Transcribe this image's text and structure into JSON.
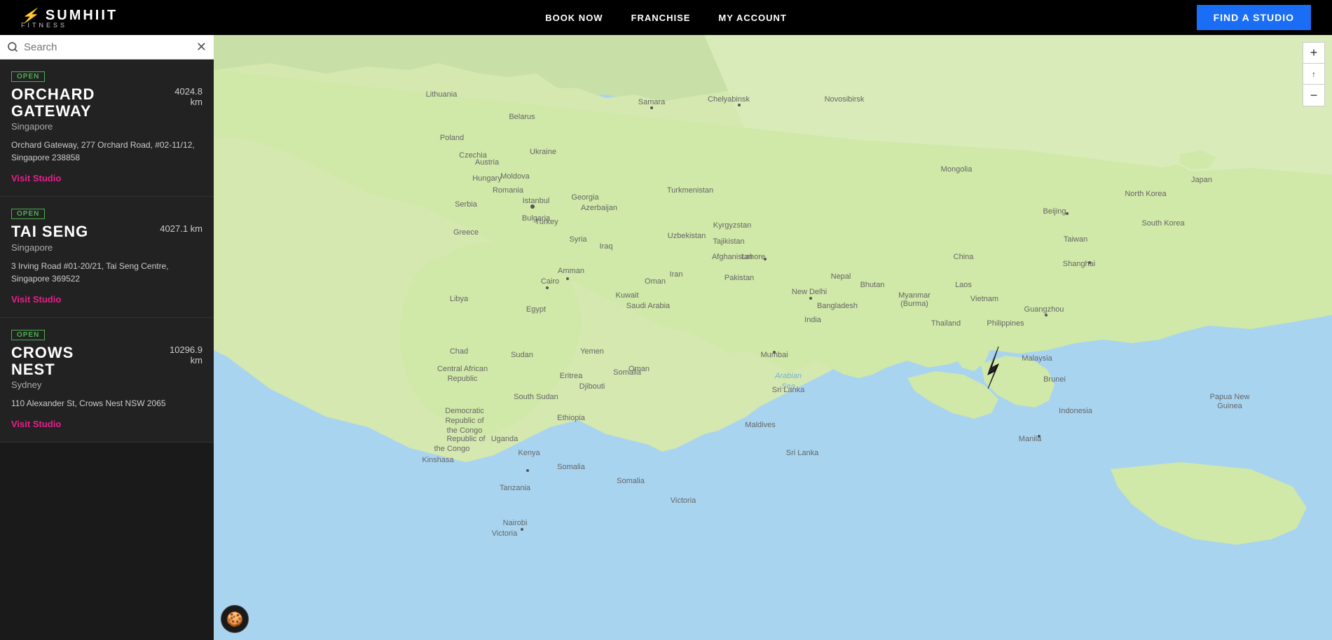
{
  "header": {
    "logo_main": "SUMHIIT",
    "logo_sub": "FITNESS",
    "nav": [
      {
        "label": "BOOK NOW",
        "id": "book-now"
      },
      {
        "label": "FRANCHISE",
        "id": "franchise"
      },
      {
        "label": "MY ACCOUNT",
        "id": "my-account"
      }
    ],
    "find_studio_label": "FIND A STUDIO"
  },
  "search": {
    "placeholder": "Search",
    "value": ""
  },
  "studios": [
    {
      "status": "OPEN",
      "name": "ORCHARD\nGATEWAY",
      "city": "Singapore",
      "distance": "4024.8\nkm",
      "address": "Orchard Gateway, 277 Orchard Road, #02-11/12, Singapore 238858",
      "visit_label": "Visit Studio"
    },
    {
      "status": "OPEN",
      "name": "TAI SENG",
      "city": "Singapore",
      "distance": "4027.1 km",
      "address": "3 Irving Road #01-20/21, Tai Seng Centre, Singapore 369522",
      "visit_label": "Visit Studio"
    },
    {
      "status": "OPEN",
      "name": "CROWS\nNEST",
      "city": "Sydney",
      "distance": "10296.9\nkm",
      "address": "110 Alexander St, Crows Nest NSW 2065",
      "visit_label": "Visit Studio"
    }
  ],
  "map": {
    "zoom_in": "+",
    "zoom_reset": "⊙",
    "zoom_out": "−",
    "south_korea_label": "South Korea",
    "marker_region": "Malaysia",
    "cookie_icon": "🍪"
  }
}
